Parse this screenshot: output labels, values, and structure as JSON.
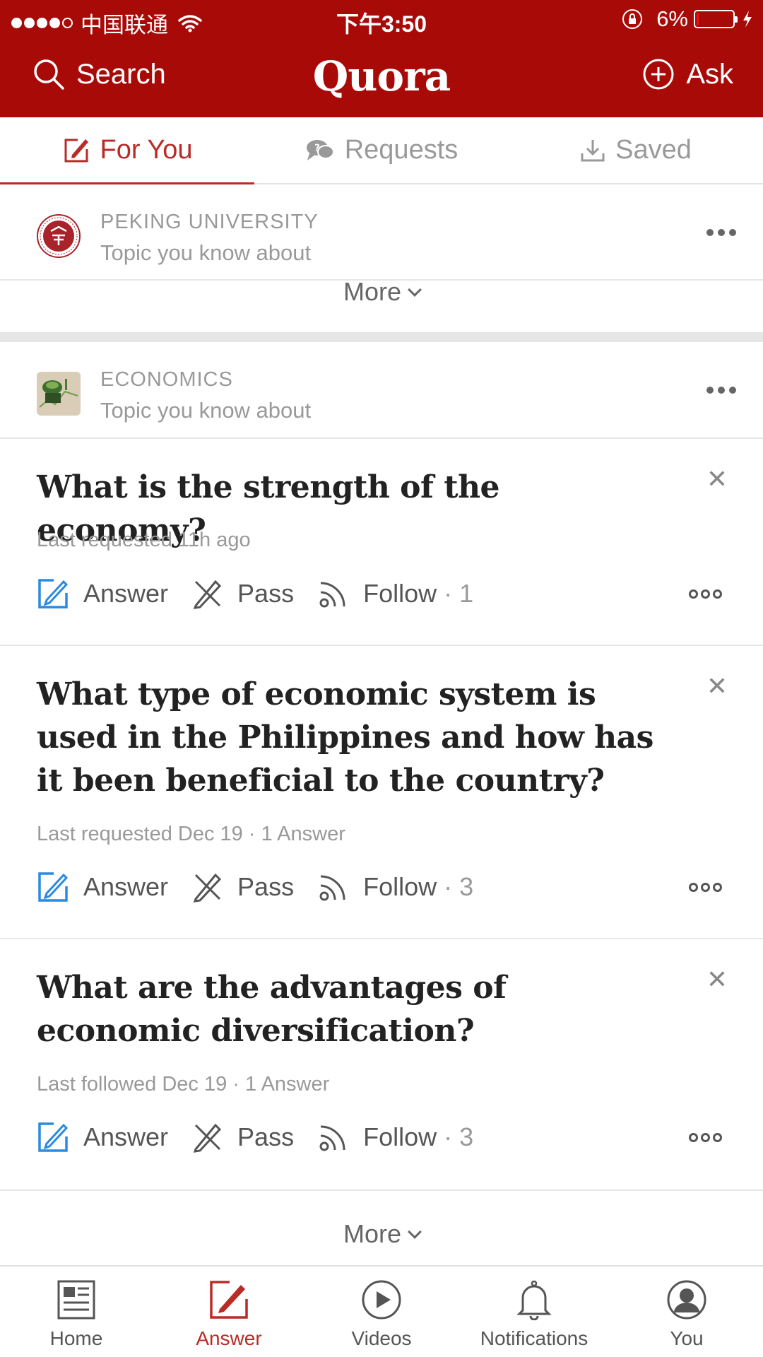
{
  "status_bar": {
    "carrier": "中国联通",
    "time": "下午3:50",
    "battery": "6%",
    "battery_level": 0.06
  },
  "header": {
    "search_label": "Search",
    "logo": "Quora",
    "ask_label": "Ask"
  },
  "tabs": [
    {
      "label": "For You",
      "icon": "pencil-square-icon",
      "active": true
    },
    {
      "label": "Requests",
      "icon": "chat-bubbles-icon",
      "active": false
    },
    {
      "label": "Saved",
      "icon": "download-icon",
      "active": false
    }
  ],
  "topics": [
    {
      "name": "PEKING UNIVERSITY",
      "subtitle": "Topic you know about",
      "icon": "university-seal-icon"
    },
    {
      "name": "ECONOMICS",
      "subtitle": "Topic you know about",
      "icon": "economics-image-icon"
    }
  ],
  "more_label": "More",
  "actions": {
    "answer": "Answer",
    "pass": "Pass",
    "follow": "Follow"
  },
  "questions": [
    {
      "title": "What is the strength of the economy?",
      "meta": "Last requested 11h ago",
      "follow_count": "· 1"
    },
    {
      "title": "What type of economic system is used in the Philippines and how has it been beneficial to the country?",
      "meta": "Last requested Dec 19 · 1 Answer",
      "follow_count": "· 3"
    },
    {
      "title": "What are the advantages of economic diversification?",
      "meta": "Last followed Dec 19 · 1 Answer",
      "follow_count": "· 3"
    }
  ],
  "bottom_nav": [
    {
      "label": "Home",
      "icon": "home-icon",
      "active": false
    },
    {
      "label": "Answer",
      "icon": "answer-icon",
      "active": true
    },
    {
      "label": "Videos",
      "icon": "play-icon",
      "active": false
    },
    {
      "label": "Notifications",
      "icon": "bell-icon",
      "active": false
    },
    {
      "label": "You",
      "icon": "profile-icon",
      "active": false
    }
  ],
  "colors": {
    "brand": "#a80a08",
    "accent": "#b92b27",
    "answer_icon": "#2b8ae0"
  }
}
